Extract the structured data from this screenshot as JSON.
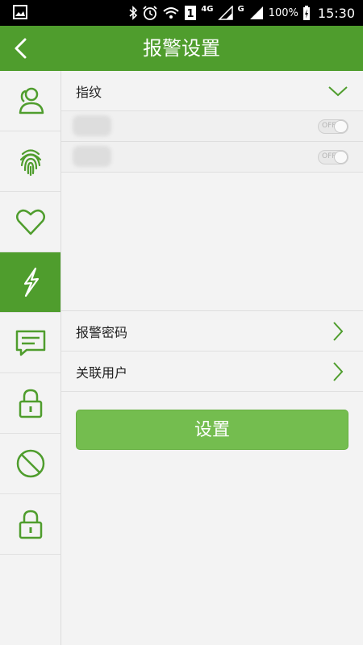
{
  "status_bar": {
    "network_1": "4G",
    "network_2": "G",
    "battery": "100%",
    "time": "15:30"
  },
  "header": {
    "title": "报警设置"
  },
  "sidebar": {
    "items": [
      {
        "icon": "contacts-icon",
        "active": false
      },
      {
        "icon": "fingerprint-icon",
        "active": false
      },
      {
        "icon": "heart-icon",
        "active": false
      },
      {
        "icon": "lightning-icon",
        "active": true
      },
      {
        "icon": "message-icon",
        "active": false
      },
      {
        "icon": "lock-icon",
        "active": false
      },
      {
        "icon": "forbidden-icon",
        "active": false
      },
      {
        "icon": "lock-icon",
        "active": false
      }
    ]
  },
  "main": {
    "section_label": "指纹",
    "entries": [
      {
        "toggle_text": "OFF"
      },
      {
        "toggle_text": "OFF"
      }
    ],
    "alarm_password_label": "报警密码",
    "linked_user_label": "关联用户",
    "set_button_label": "设置"
  },
  "colors": {
    "primary": "#4f9d2d",
    "button": "#74bd4f",
    "background": "#f3f3f3"
  }
}
